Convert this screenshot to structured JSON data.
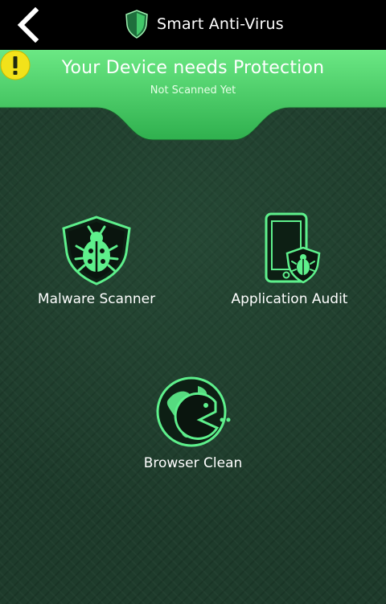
{
  "topbar": {
    "back_icon": "chevron-left-icon",
    "logo_icon": "shield-logo-icon",
    "title": "Smart Anti-Virus"
  },
  "banner": {
    "title": "Your Device needs Protection",
    "subtitle": "Not Scanned Yet",
    "status_icon": "warning-icon",
    "colors": {
      "banner": "#4cd46a",
      "warning": "#f2e21a"
    }
  },
  "features": {
    "malware": {
      "label": "Malware Scanner",
      "icon": "bug-shield-icon"
    },
    "audit": {
      "label": "Application Audit",
      "icon": "phone-bug-icon"
    },
    "browser": {
      "label": "Browser Clean",
      "icon": "globe-pacman-icon"
    }
  },
  "colors": {
    "background": "#1e3b2b",
    "accent": "#5ef08c",
    "topbar": "#000000"
  }
}
